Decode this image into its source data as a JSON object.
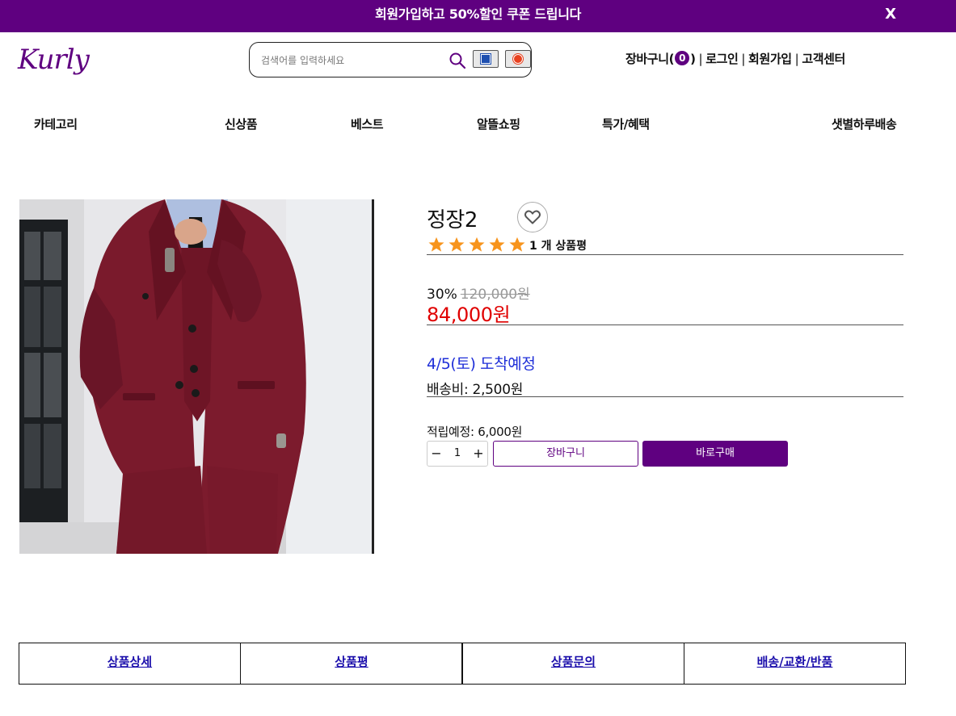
{
  "banner": {
    "message": "회원가입하고 50%할인 쿠폰 드립니다",
    "close": "X"
  },
  "header": {
    "logo": "Kurly",
    "search": {
      "placeholder": "검색어를 입력하세요",
      "value": ""
    },
    "cart_label": "장바구니(",
    "cart_count": "0",
    "cart_close": ")",
    "login": "로그인",
    "signup": "회원가입",
    "support": "고객센터",
    "separator": "|"
  },
  "nav": {
    "category": "카테고리",
    "new": "신상품",
    "best": "베스트",
    "saving": "알뜰쇼핑",
    "special": "특가/혜택",
    "dawn": "샛별하루배송"
  },
  "product": {
    "title": "정장2",
    "rating": 5,
    "review_count_text": "1 개 상품평",
    "discount": "30%",
    "original_price": "120,000원",
    "price": "84,000원",
    "arrival": "4/5(토) 도착예정",
    "shipping": "배송비: 2,500원",
    "points": "적립예정: 6,000원",
    "quantity": "1",
    "minus": "−",
    "plus": "+",
    "cart_button": "장바구니",
    "buy_button": "바로구매"
  },
  "colors": {
    "brand": "#5f0080",
    "price": "#e00000",
    "arrival": "#1f2fd8",
    "star": "#f7941d"
  },
  "tabs": [
    "상품상세",
    "상품평",
    "상품문의",
    "배송/교환/반품"
  ]
}
